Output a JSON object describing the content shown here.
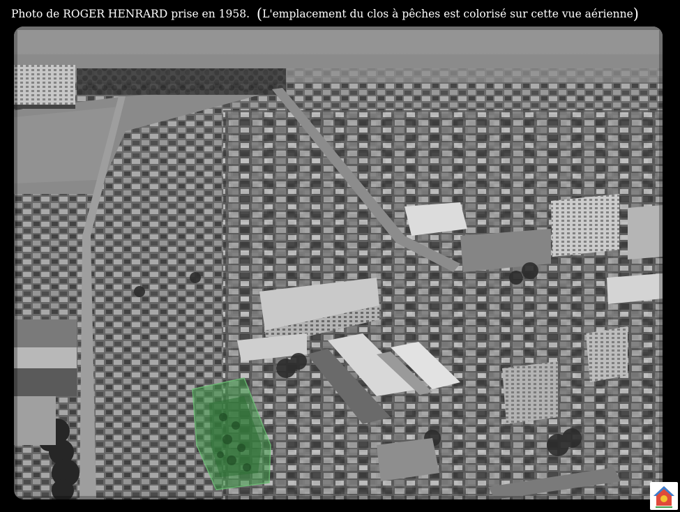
{
  "caption": {
    "main": "Photo de ROGER HENRARD prise en 1958.",
    "open_paren": "(",
    "note": "L'emplacement du clos à pêches est colorisé sur cette vue aérienne",
    "close_paren": ")"
  },
  "photo": {
    "content": "aerial-view-town",
    "tone": "black-and-white",
    "highlight_color": "#3f9a48"
  },
  "logo": {
    "icon": "house-logo-icon"
  }
}
